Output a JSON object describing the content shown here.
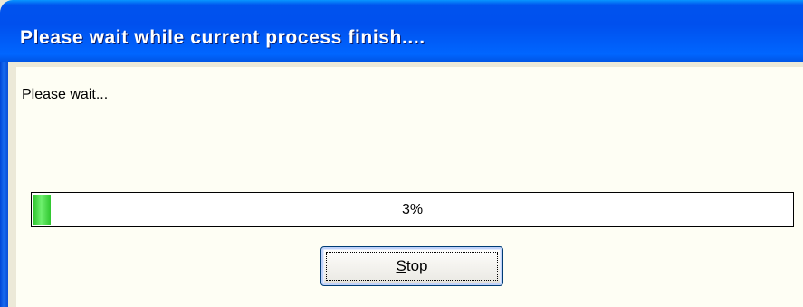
{
  "window": {
    "title": "Please wait while current process finish...."
  },
  "dialog": {
    "message": "Please wait...",
    "progress": {
      "percent": 3,
      "label": "3%"
    },
    "stop_button": {
      "label": "Stop",
      "mnemonic": "S"
    }
  },
  "colors": {
    "titlebar": "#0055e5",
    "panel_background": "#fefef4",
    "progress_fill": "#2fc62f",
    "button_border": "#003c74"
  }
}
